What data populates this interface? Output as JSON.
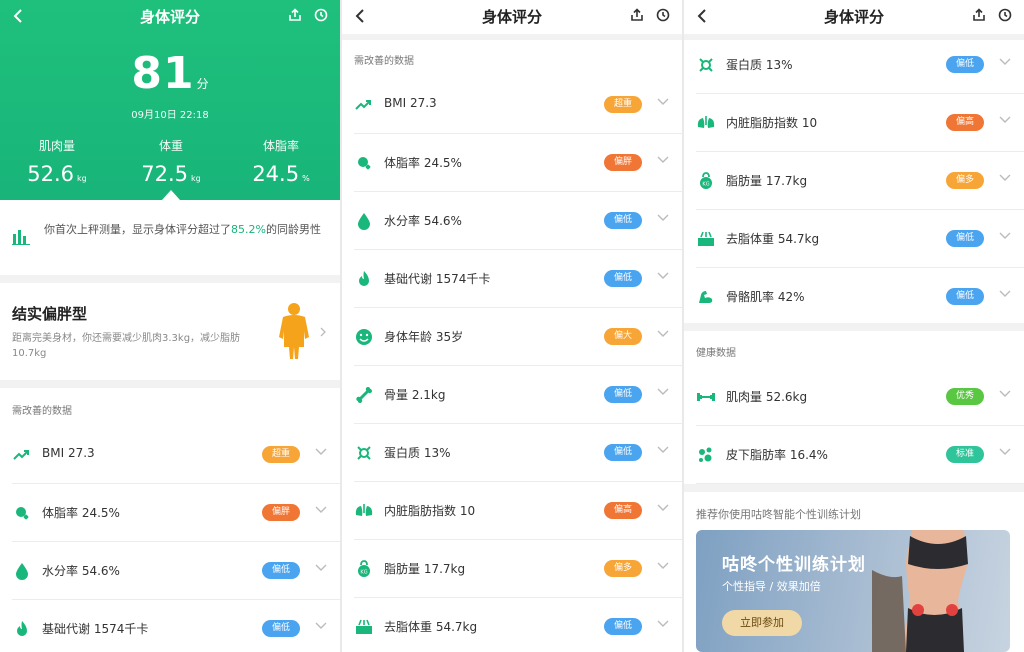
{
  "colors": {
    "primary": "#19b77b",
    "badge_orange": "#f7a537",
    "badge_red": "#f07636",
    "badge_blue": "#4aa4ef",
    "badge_green": "#5ac743",
    "badge_teal": "#2fc49a",
    "icon_green": "#19b77b"
  },
  "panel1": {
    "title": "身体评分",
    "back_icon": "back-arrow-icon",
    "share_icon": "share-icon",
    "history_icon": "clock-icon",
    "score": "81",
    "score_unit": "分",
    "date": "09月10日 22:18",
    "metrics": [
      {
        "label": "肌肉量",
        "value": "52.6",
        "unit": "kg"
      },
      {
        "label": "体重",
        "value": "72.5",
        "unit": "kg"
      },
      {
        "label": "体脂率",
        "value": "24.5",
        "unit": "%"
      }
    ],
    "tip_prefix": "你首次上秤测量，显示身体评分超过了",
    "tip_percent": "85.2%",
    "tip_suffix": "的同龄男性",
    "body_type_title": "结实偏胖型",
    "body_type_desc": "距离完美身材，你还需要减少肌肉3.3kg，减少脂肪10.7kg",
    "section_title": "需改善的数据",
    "rows": [
      {
        "label": "BMI 27.3",
        "badge": "超重",
        "icon": "trend-up-icon"
      },
      {
        "label": "体脂率 24.5%",
        "badge": "偏胖",
        "icon": "body-fat-icon"
      },
      {
        "label": "水分率 54.6%",
        "badge": "偏低",
        "icon": "water-drop-icon"
      },
      {
        "label": "基础代谢 1574千卡",
        "badge": "偏低",
        "icon": "flame-icon"
      }
    ]
  },
  "panel2": {
    "title": "身体评分",
    "section_title": "需改善的数据",
    "rows": [
      {
        "label": "BMI 27.3",
        "badge": "超重",
        "icon": "trend-up-icon"
      },
      {
        "label": "体脂率 24.5%",
        "badge": "偏胖",
        "icon": "body-fat-icon"
      },
      {
        "label": "水分率 54.6%",
        "badge": "偏低",
        "icon": "water-drop-icon"
      },
      {
        "label": "基础代谢 1574千卡",
        "badge": "偏低",
        "icon": "flame-icon"
      },
      {
        "label": "身体年龄 35岁",
        "badge": "偏大",
        "icon": "smile-icon"
      },
      {
        "label": "骨量 2.1kg",
        "badge": "偏低",
        "icon": "bone-icon"
      },
      {
        "label": "蛋白质 13%",
        "badge": "偏低",
        "icon": "protein-icon"
      },
      {
        "label": "内脏脂肪指数 10",
        "badge": "偏高",
        "icon": "visceral-fat-icon"
      },
      {
        "label": "脂肪量 17.7kg",
        "badge": "偏多",
        "icon": "weight-kettle-icon"
      },
      {
        "label": "去脂体重 54.7kg",
        "badge": "偏低",
        "icon": "lean-mass-icon"
      }
    ]
  },
  "panel3": {
    "title": "身体评分",
    "rows": [
      {
        "label": "蛋白质 13%",
        "badge": "偏低",
        "icon": "protein-icon"
      },
      {
        "label": "内脏脂肪指数 10",
        "badge": "偏高",
        "icon": "visceral-fat-icon"
      },
      {
        "label": "脂肪量 17.7kg",
        "badge": "偏多",
        "icon": "weight-kettle-icon"
      },
      {
        "label": "去脂体重 54.7kg",
        "badge": "偏低",
        "icon": "lean-mass-icon"
      },
      {
        "label": "骨骼肌率 42%",
        "badge": "偏低",
        "icon": "muscle-arm-icon"
      }
    ],
    "health_title": "健康数据",
    "health_rows": [
      {
        "label": "肌肉量 52.6kg",
        "badge": "优秀",
        "icon": "dumbbell-icon"
      },
      {
        "label": "皮下脂肪率 16.4%",
        "badge": "标准",
        "icon": "subcutaneous-fat-icon"
      }
    ],
    "recommend_text": "推荐你使用咕咚智能个性训练计划",
    "promo_title": "咕咚个性训练计划",
    "promo_subtitle": "个性指导 / 效果加倍",
    "promo_button": "立即参加"
  }
}
